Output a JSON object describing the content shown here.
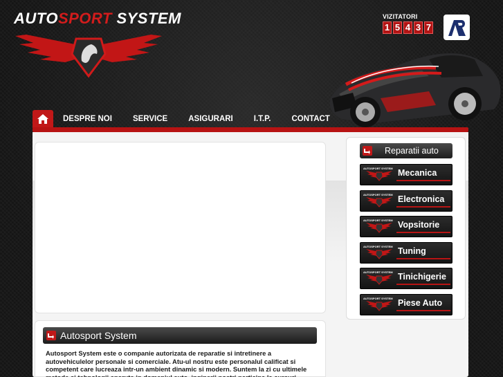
{
  "logo": {
    "text_white": "AUTO",
    "text_red": "SPORT",
    "text_white2": " SYSTEM"
  },
  "visitors": {
    "label": "VIZITATORI",
    "digits": [
      "1",
      "5",
      "4",
      "3",
      "7"
    ]
  },
  "badge": {
    "icon": "ar-logo-icon"
  },
  "nav": {
    "home_icon": "home-icon",
    "items": [
      "DESPRE NOI",
      "SERVICE",
      "ASIGURARI",
      "I.T.P.",
      "CONTACT"
    ]
  },
  "sidebar": {
    "header": "Reparatii auto",
    "mini_logo_text": "AUTOSPORT SYSTEM",
    "items": [
      "Mecanica",
      "Electronica",
      "Vopsitorie",
      "Tuning",
      "Tinichigerie",
      "Piese Auto"
    ]
  },
  "about": {
    "title": "Autosport System",
    "text": "Autosport System este o companie autorizata de reparatie si intretinere a autovehiculelor personale si comerciale. Atu-ul nostru este personalul calificat si competent care lucreaza intr-un ambient dinamic si modern. Suntem la zi cu ultimele metode si tehnologii aparute in domeniul auto, inginerii nostri participa la cursuri periodice de specializare."
  },
  "colors": {
    "accent": "#c11818",
    "dark": "#1e1e1e",
    "panel": "#f4f4f4"
  }
}
